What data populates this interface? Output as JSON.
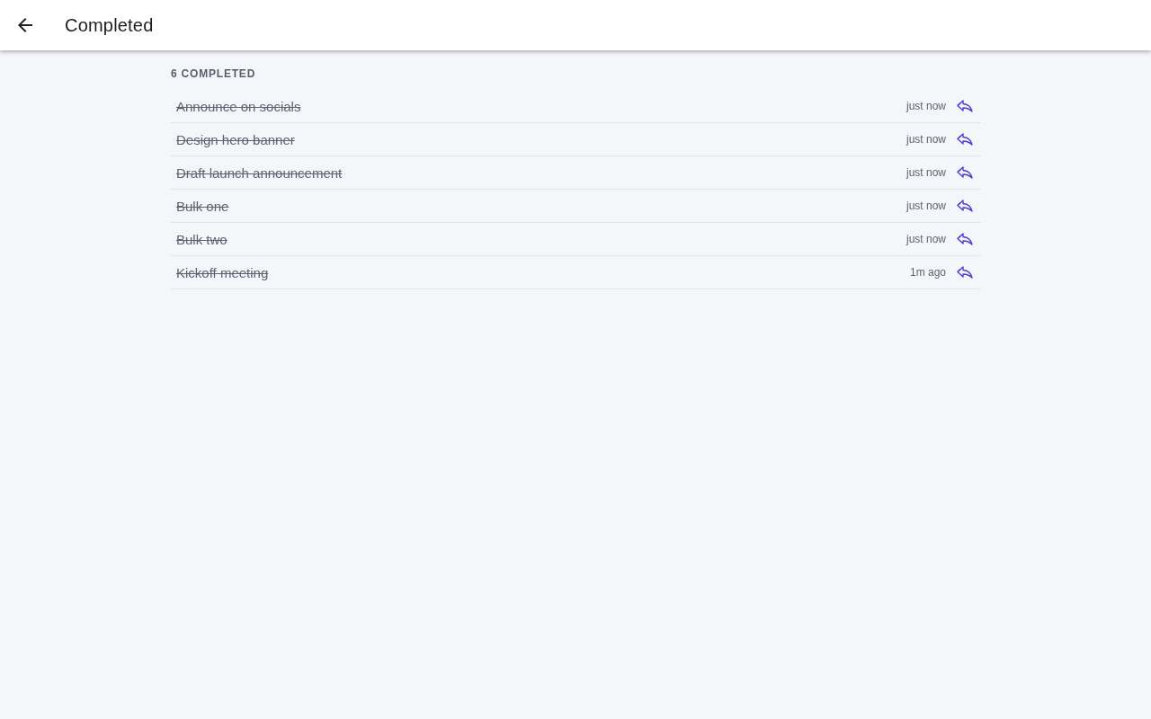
{
  "app_bar": {
    "title": "Completed"
  },
  "section": {
    "label": "6 COMPLETED"
  },
  "items": [
    {
      "title": "Announce on socials",
      "time": "just now",
      "completed": true
    },
    {
      "title": "Design hero banner",
      "time": "just now",
      "completed": true
    },
    {
      "title": "Draft launch announcement",
      "time": "just now",
      "completed": true
    },
    {
      "title": "Bulk one",
      "time": "just now",
      "completed": true
    },
    {
      "title": "Bulk two",
      "time": "just now",
      "completed": true
    },
    {
      "title": "Kickoff meeting",
      "time": "1m ago",
      "completed": true
    }
  ]
}
